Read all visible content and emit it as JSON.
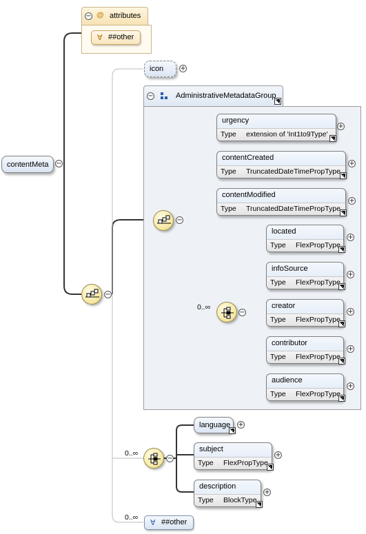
{
  "root": {
    "name": "contentMeta"
  },
  "attributes": {
    "label": "attributes",
    "any_label": "##other",
    "any_symbol": "∀",
    "at_symbol": "@"
  },
  "elements": {
    "icon": {
      "name": "icon"
    },
    "group": {
      "name": "AdministrativeMetadataGroup"
    },
    "urgency": {
      "name": "urgency",
      "type_key": "Type",
      "type_value": "extension of 'Int1to9Type'"
    },
    "contentCreated": {
      "name": "contentCreated",
      "type_key": "Type",
      "type_value": "TruncatedDateTimePropType"
    },
    "contentModified": {
      "name": "contentModified",
      "type_key": "Type",
      "type_value": "TruncatedDateTimePropType"
    },
    "located": {
      "name": "located",
      "type_key": "Type",
      "type_value": "FlexPropType"
    },
    "infoSource": {
      "name": "infoSource",
      "type_key": "Type",
      "type_value": "FlexPropType"
    },
    "creator": {
      "name": "creator",
      "type_key": "Type",
      "type_value": "FlexPropType"
    },
    "contributor": {
      "name": "contributor",
      "type_key": "Type",
      "type_value": "FlexPropType"
    },
    "audience": {
      "name": "audience",
      "type_key": "Type",
      "type_value": "FlexPropType"
    },
    "language": {
      "name": "language"
    },
    "subject": {
      "name": "subject",
      "type_key": "Type",
      "type_value": "FlexPropType"
    },
    "description": {
      "name": "description",
      "type_key": "Type",
      "type_value": "BlockType"
    },
    "other": {
      "symbol": "∀",
      "label": "##other"
    }
  },
  "occurrences": {
    "choice_inner": "0..∞",
    "choice_lower": "0..∞",
    "any_other": "0..∞"
  },
  "toggle_symbols": {
    "collapse": "−",
    "expand": "+"
  }
}
